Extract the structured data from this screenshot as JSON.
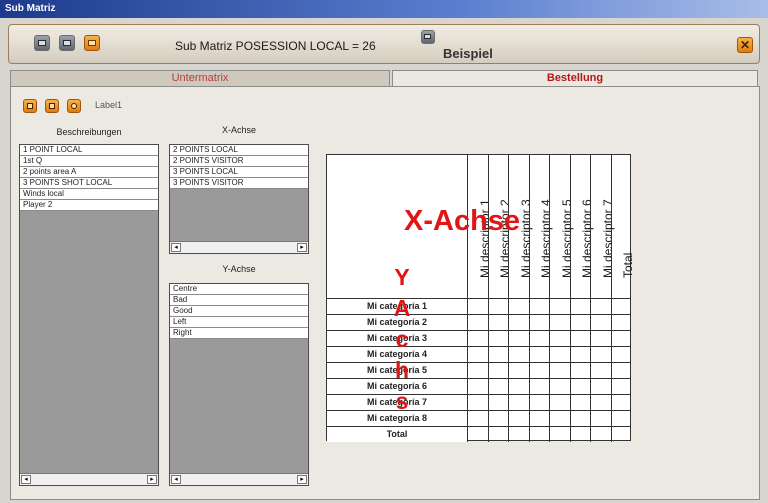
{
  "window": {
    "title": "Sub Matriz"
  },
  "toolbar": {
    "title": "Sub Matriz POSESSION LOCAL = 26",
    "icons": [
      "printer-icon",
      "camera-icon",
      "film-icon",
      "save-icon",
      "close-icon"
    ],
    "close_label": "✕"
  },
  "tabs": [
    {
      "label": "Untermatrix",
      "active": false
    },
    {
      "label": "Bestellung",
      "active": true
    }
  ],
  "content": {
    "label1": "Label1",
    "beschreibungen": {
      "header": "Beschreibungen",
      "items": [
        "1 POINT LOCAL",
        "1st Q",
        "2 points area A",
        "3 POINTS SHOT LOCAL",
        "Winds local",
        "Player 2"
      ]
    },
    "x_achse": {
      "header": "X-Achse",
      "items": [
        "2 POINTS LOCAL",
        "2 POINTS VISITOR",
        "3 POINTS LOCAL",
        "3 POINTS VISITOR"
      ]
    },
    "y_achse": {
      "header": "Y-Achse",
      "items": [
        "Centre",
        "Bad",
        "Good",
        "Left",
        "Right"
      ]
    },
    "scroll_left": "◂",
    "scroll_right": "▸"
  },
  "matrix": {
    "title": "Beispiel",
    "columns": [
      "Mi descriptor 1",
      "Mi descriptor 2",
      "Mi descriptor 3",
      "Mi descriptor 4",
      "Mi descriptor 5",
      "Mi descriptor 6",
      "Mi descriptor 7",
      "Total"
    ],
    "rows": [
      "Mi categoría 1",
      "Mi categoría 2",
      "Mi categoría 3",
      "Mi categoría 4",
      "Mi categoría 5",
      "Mi categoría 6",
      "Mi categoría 7",
      "Mi categoría 8",
      "Total"
    ],
    "x_overlay": "X-Achse",
    "y_overlay": "Y Achs"
  },
  "colors": {
    "accent": "#e07c10",
    "overlay": "#e01515",
    "tab_active": "#b21818"
  }
}
